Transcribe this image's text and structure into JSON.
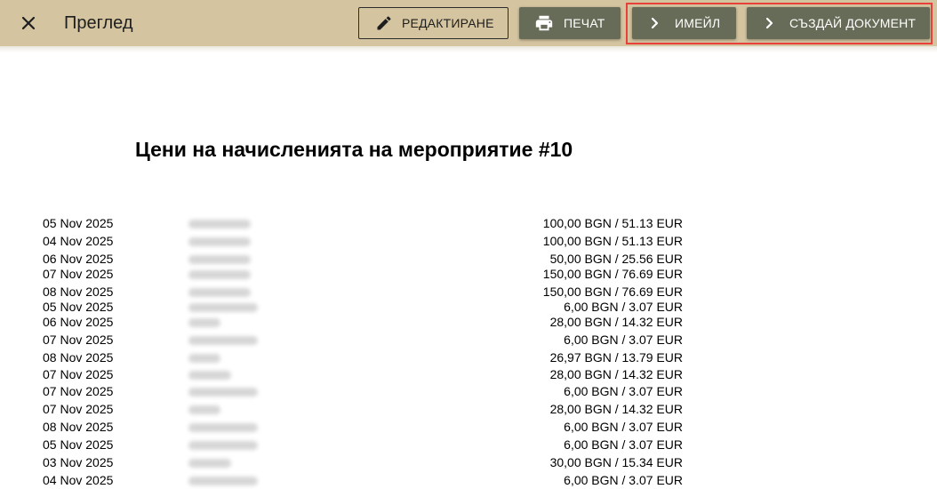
{
  "header": {
    "title": "Преглед",
    "close_icon": "close-icon",
    "buttons": {
      "edit": {
        "label": "РЕДАКТИРАНЕ",
        "icon": "pencil-icon"
      },
      "print": {
        "label": "ПЕЧАТ",
        "icon": "printer-icon"
      },
      "email": {
        "label": "ИМЕЙЛ",
        "icon": "chevron-right-icon"
      },
      "create_document": {
        "label": "СЪЗДАЙ ДОКУМЕНТ",
        "icon": "chevron-right-icon"
      }
    },
    "colors": {
      "toolbar_bg": "#d4c4a0",
      "button_bg": "#676c58",
      "highlight": "#e8403a"
    }
  },
  "document": {
    "title": "Цени на начисленията на мероприятие #10",
    "rows": [
      {
        "date": "05 Nov 2025",
        "price": "100,00 BGN / 51.13 EUR"
      },
      {
        "date": "04 Nov 2025",
        "price": "100,00 BGN / 51.13 EUR"
      },
      {
        "date": "06 Nov 2025",
        "price": "50,00 BGN / 25.56 EUR"
      },
      {
        "date": "07 Nov 2025",
        "price": "150,00 BGN / 76.69 EUR"
      },
      {
        "date": "08 Nov 2025",
        "price": "150,00 BGN / 76.69 EUR"
      },
      {
        "date": "05 Nov 2025",
        "price": "6,00 BGN / 3.07 EUR"
      },
      {
        "date": "06 Nov 2025",
        "price": "28,00 BGN / 14.32 EUR"
      },
      {
        "date": "07 Nov 2025",
        "price": "6,00 BGN / 3.07 EUR"
      },
      {
        "date": "08 Nov 2025",
        "price": "26,97 BGN / 13.79 EUR"
      },
      {
        "date": "07 Nov 2025",
        "price": "28,00 BGN / 14.32 EUR"
      },
      {
        "date": "07 Nov 2025",
        "price": "6,00 BGN / 3.07 EUR"
      },
      {
        "date": "07 Nov 2025",
        "price": "28,00 BGN / 14.32 EUR"
      },
      {
        "date": "08 Nov 2025",
        "price": "6,00 BGN / 3.07 EUR"
      },
      {
        "date": "05 Nov 2025",
        "price": "6,00 BGN / 3.07 EUR"
      },
      {
        "date": "03 Nov 2025",
        "price": "30,00 BGN / 15.34 EUR"
      },
      {
        "date": "04 Nov 2025",
        "price": "6,00 BGN / 3.07 EUR"
      }
    ]
  }
}
